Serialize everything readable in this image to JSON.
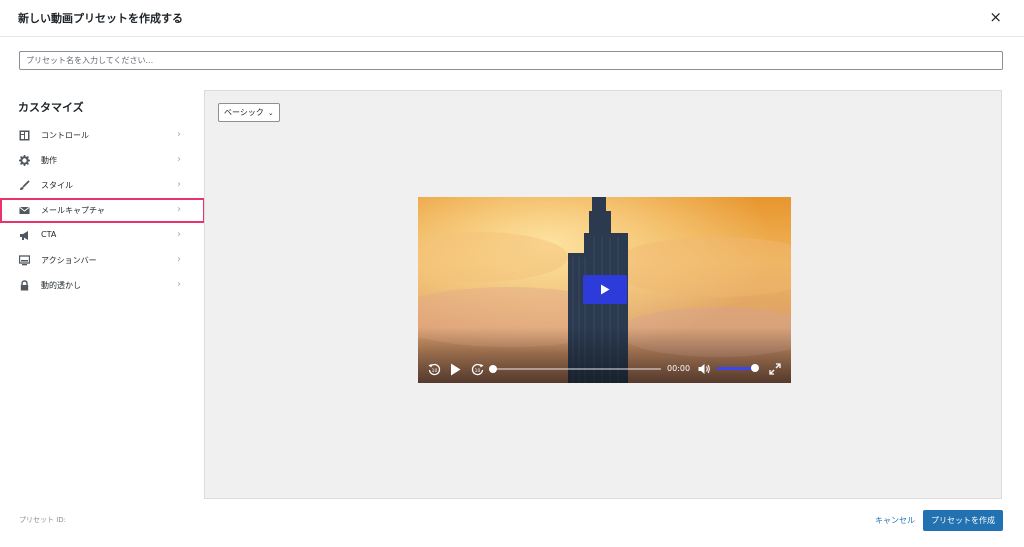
{
  "modal": {
    "title": "新しい動画プリセットを作成する",
    "close_label": "×"
  },
  "name_input": {
    "placeholder": "プリセット名を入力してください...",
    "value": ""
  },
  "sidebar": {
    "title": "カスタマイズ",
    "items": [
      {
        "label": "コントロール",
        "icon": "controls-icon"
      },
      {
        "label": "動作",
        "icon": "gear-icon"
      },
      {
        "label": "スタイル",
        "icon": "brush-icon"
      },
      {
        "label": "メールキャプチャ",
        "icon": "envelope-icon",
        "highlighted": true
      },
      {
        "label": "CTA",
        "icon": "megaphone-icon"
      },
      {
        "label": "アクションバー",
        "icon": "monitor-icon"
      },
      {
        "label": "動的透かし",
        "icon": "lock-icon"
      }
    ]
  },
  "preview": {
    "preset_select": "ベーシック",
    "player": {
      "time": "00:00",
      "seek_progress": 0,
      "volume_level": 1.0,
      "accent_color": "#2e3bdb"
    }
  },
  "footer": {
    "preset_id_label": "プリセット ID:",
    "cancel_label": "キャンセル",
    "create_label": "プリセットを作成"
  },
  "colors": {
    "primary": "#2271b1",
    "highlight_border": "#e8336b",
    "preview_bg": "#f0f0f1"
  }
}
